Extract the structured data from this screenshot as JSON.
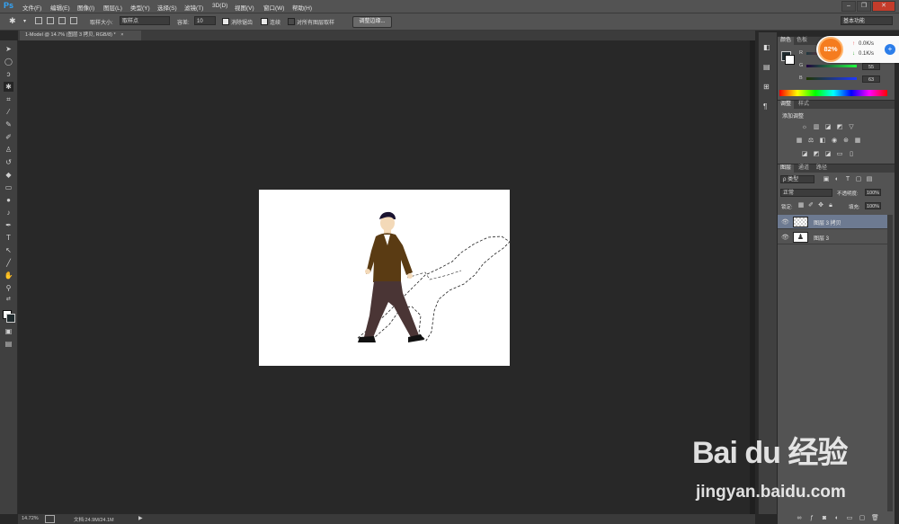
{
  "app": {
    "logo": "Ps",
    "workspace": "基本功能"
  },
  "menu": [
    "文件(F)",
    "编辑(E)",
    "图像(I)",
    "图层(L)",
    "类型(Y)",
    "选择(S)",
    "滤镜(T)",
    "3D(D)",
    "视图(V)",
    "窗口(W)",
    "帮助(H)"
  ],
  "window_controls": {
    "minimize": "–",
    "restore": "❐",
    "close": "✕"
  },
  "options": {
    "sample_size_label": "取样大小:",
    "sample_size_value": "取样点",
    "tolerance_label": "容差:",
    "tolerance_value": "10",
    "antialias_label": "消除锯齿",
    "contiguous_label": "连续",
    "sample_all_label": "对所有图层取样",
    "refine_edge_button": "调整边缘..."
  },
  "document": {
    "tab_title": "1-Model @ 14.7% (图层 3 拷贝, RGB/8) *",
    "tab_close": "×",
    "zoom": "14.72%",
    "doc_info": "文档:24.9M/24.1M"
  },
  "color_panel": {
    "tabs": [
      "颜色",
      "色板"
    ],
    "channels": [
      {
        "label": "R",
        "value": ""
      },
      {
        "label": "G",
        "value": "55"
      },
      {
        "label": "B",
        "value": "63"
      }
    ],
    "fg_color": "#1f2a2d",
    "bg_color": "#ffffff"
  },
  "adjustments_panel": {
    "tabs": [
      "调整",
      "样式"
    ],
    "header": "添加调整"
  },
  "layers_panel": {
    "tabs": [
      "图层",
      "通道",
      "路径"
    ],
    "filter_label": "ρ 类型",
    "blend_mode": "正常",
    "opacity_label": "不透明度:",
    "opacity_value": "100%",
    "lock_label": "锁定:",
    "fill_label": "填充:",
    "fill_value": "100%",
    "layers": [
      {
        "name": "图层 3 拷贝",
        "selected": true,
        "thumb": "transparent"
      },
      {
        "name": "图层 3",
        "selected": false,
        "thumb": "figure"
      }
    ],
    "footer_icons": [
      "link-icon",
      "fx-icon",
      "mask-icon",
      "adjustment-icon",
      "group-icon",
      "new-layer-icon",
      "delete-icon"
    ]
  },
  "speed_widget": {
    "percent": "82%",
    "up": "0.0K/s",
    "down": "0.1K/s"
  },
  "watermark": {
    "logo_text": "Bai du 经验",
    "url": "jingyan.baidu.com"
  }
}
